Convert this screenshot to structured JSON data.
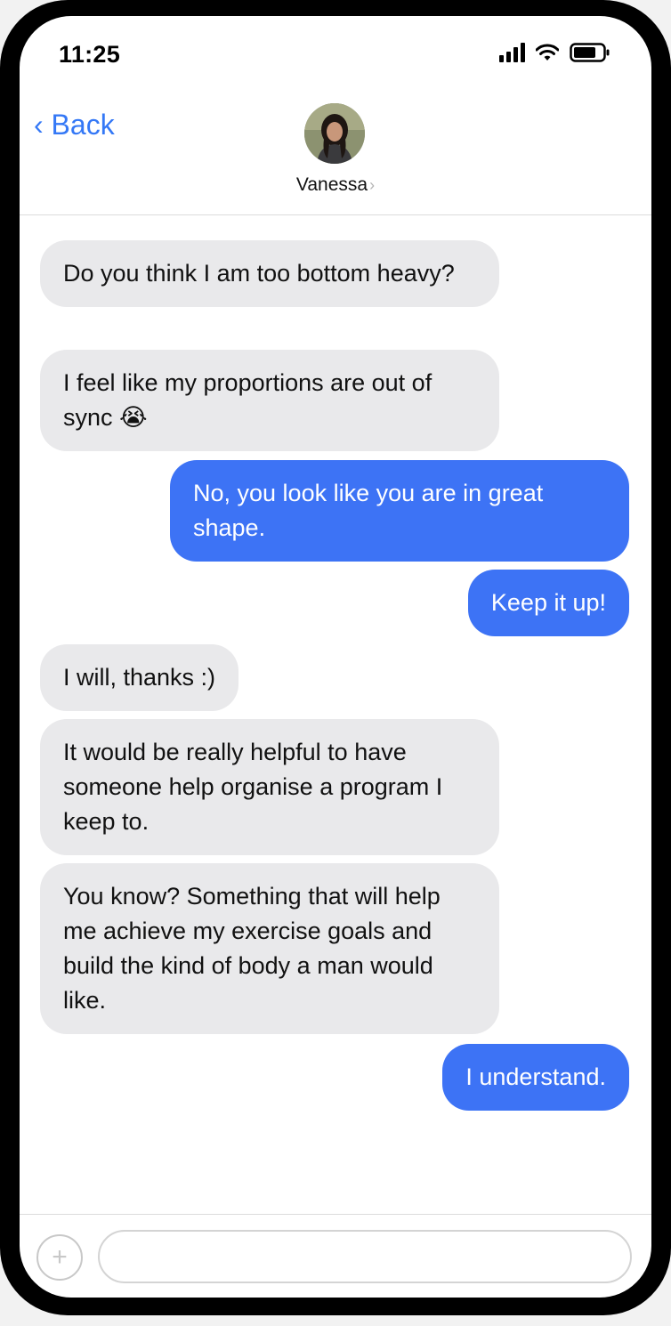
{
  "status_bar": {
    "time": "11:25",
    "icons": [
      "signal-icon",
      "wifi-icon",
      "battery-icon"
    ]
  },
  "header": {
    "back_label": "‹ Back",
    "contact_name": "Vanessa",
    "chevron": "›"
  },
  "messages": [
    {
      "direction": "incoming",
      "text": "Do you think I am too bottom heavy?"
    },
    {
      "direction": "incoming",
      "text": "I feel like my proportions are out of sync 😭"
    },
    {
      "direction": "outgoing",
      "text": "No, you look like you are in great shape."
    },
    {
      "direction": "outgoing",
      "text": "Keep it up!"
    },
    {
      "direction": "incoming",
      "text": "I will, thanks :)"
    },
    {
      "direction": "incoming",
      "text": "It would be really helpful to have someone help organise a program I keep to."
    },
    {
      "direction": "incoming",
      "text": "You know? Something that will help me achieve my exercise goals and build the kind of body a man would like."
    },
    {
      "direction": "outgoing",
      "text": "I understand."
    }
  ],
  "composer": {
    "add_label": "+",
    "input_value": ""
  },
  "colors": {
    "accent": "#3478f6",
    "outgoing_bubble": "#3d73f5",
    "incoming_bubble": "#e9e9eb"
  }
}
